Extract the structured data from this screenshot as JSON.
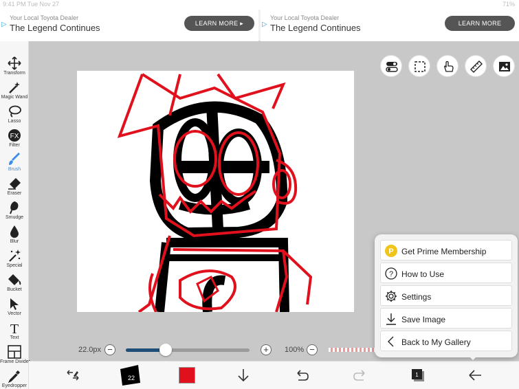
{
  "status_bar": {
    "time": "9:41 PM   Tue Nov 27",
    "battery": "71%"
  },
  "ads": [
    {
      "sub": "Your Local Toyota Dealer",
      "headline": "The Legend Continues",
      "cta": "LEARN MORE ▸"
    },
    {
      "sub": "Your Local Toyota Dealer",
      "headline": "The Legend Continues",
      "cta": "LEARN MORE"
    }
  ],
  "tools": [
    {
      "label": "Transform",
      "icon": "transform-icon"
    },
    {
      "label": "Magic Wand",
      "icon": "magic-wand-icon"
    },
    {
      "label": "Lasso",
      "icon": "lasso-icon"
    },
    {
      "label": "Filter",
      "icon": "filter-icon"
    },
    {
      "label": "Brush",
      "icon": "brush-icon",
      "active": true
    },
    {
      "label": "Eraser",
      "icon": "eraser-icon"
    },
    {
      "label": "Smudge",
      "icon": "smudge-icon"
    },
    {
      "label": "Blur",
      "icon": "blur-icon"
    },
    {
      "label": "Special",
      "icon": "special-icon"
    },
    {
      "label": "Bucket",
      "icon": "bucket-icon"
    },
    {
      "label": "Vector",
      "icon": "vector-icon"
    },
    {
      "label": "Text",
      "icon": "text-icon"
    },
    {
      "label": "Frame Divider",
      "icon": "frame-divider-icon"
    },
    {
      "label": "Eyedropper",
      "icon": "eyedropper-icon"
    }
  ],
  "brush": {
    "size_label": "22.0px",
    "size_fraction": 0.32,
    "opacity_label": "100%"
  },
  "colors": {
    "accent": "#3a8ee6",
    "primary_color": "#e0101c",
    "slider_fill": "#1f4e79"
  },
  "bottom_bar": {
    "layers_count": "1",
    "brush_preview_text": "22"
  },
  "menu": {
    "items": [
      {
        "label": "Get Prime Membership",
        "icon": "prime-icon"
      },
      {
        "label": "How to Use",
        "icon": "help-icon"
      },
      {
        "label": "Settings",
        "icon": "gear-icon"
      },
      {
        "label": "Save Image",
        "icon": "download-icon"
      },
      {
        "label": "Back to My Gallery",
        "icon": "chevron-left-icon"
      }
    ]
  }
}
